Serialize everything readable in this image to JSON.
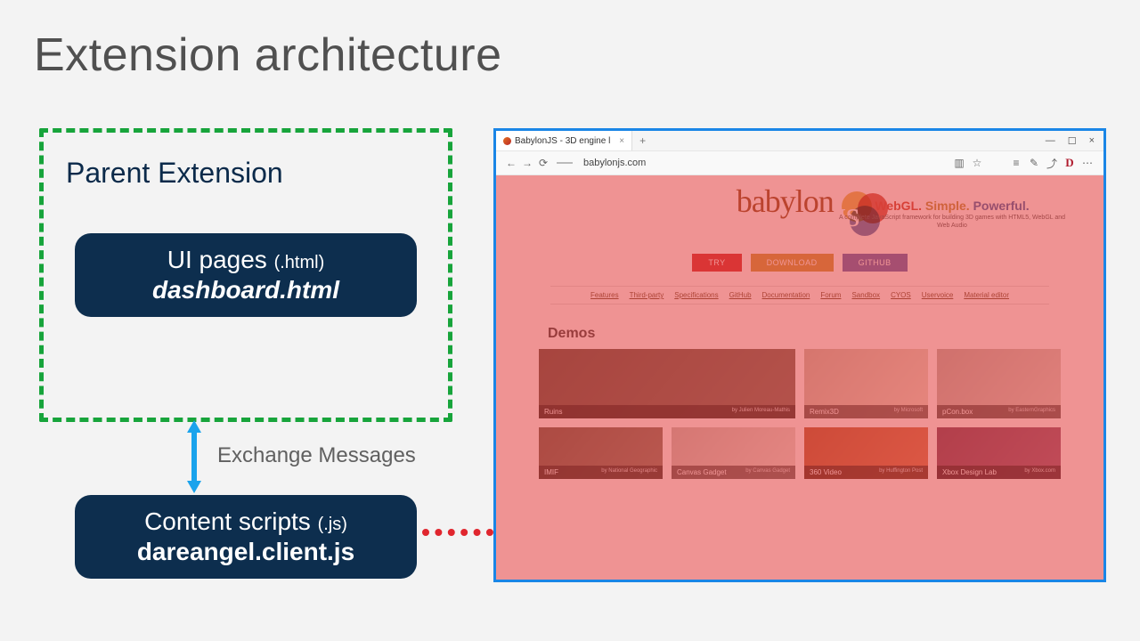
{
  "title": "Extension architecture",
  "diagram": {
    "parent_label": "Parent Extension",
    "ui_card": {
      "line1": "UI pages",
      "paren": "(.html)",
      "line2": "dashboard.html"
    },
    "cs_card": {
      "line1": "Content scripts",
      "paren": "(.js)",
      "line2": "dareangel.client.js"
    },
    "exchange_label": "Exchange Messages"
  },
  "browser": {
    "tab_title": "BabylonJS - 3D engine l",
    "url": "babylonjs.com",
    "toolbar_icons": [
      "book",
      "star",
      "lines",
      "edit",
      "share",
      "ext",
      "more"
    ],
    "win_controls": [
      "min",
      "max",
      "close"
    ]
  },
  "page": {
    "logo_text": "babylon",
    "logo_js": "JS",
    "tagline": {
      "w1": "WebGL.",
      "w2": "Simple.",
      "w3": "Powerful."
    },
    "subtag": "A complete JavaScript framework for building 3D games with HTML5, WebGL and Web Audio",
    "buttons": {
      "try": "TRY",
      "download": "DOWNLOAD",
      "github": "GITHUB"
    },
    "links": [
      "Features",
      "Third-party",
      "Specifications",
      "GitHub",
      "Documentation",
      "Forum",
      "Sandbox",
      "CYOS",
      "Uservoice",
      "Material editor"
    ],
    "demos_heading": "Demos",
    "demos_row1": [
      {
        "title": "Ruins",
        "by": "by Julien Moreau-Mathis"
      },
      {
        "title": "Remix3D",
        "by": "by Microsoft"
      },
      {
        "title": "pCon.box",
        "by": "by EasternGraphics"
      }
    ],
    "demos_row2": [
      {
        "title": "IMIF",
        "by": "by National Geographic"
      },
      {
        "title": "Canvas Gadget",
        "by": "by Canvas Gadget"
      },
      {
        "title": "360 Video",
        "by": "by Huffington Post"
      },
      {
        "title": "Xbox Design Lab",
        "by": "by Xbox.com"
      }
    ]
  }
}
